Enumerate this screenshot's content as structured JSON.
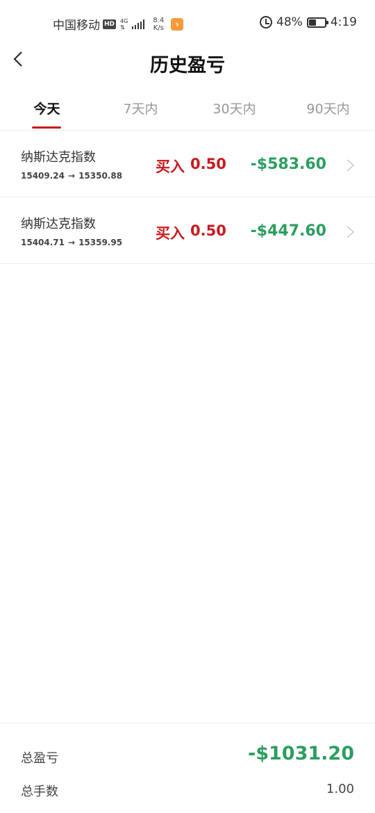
{
  "status_bar": {
    "carrier": "中国移动",
    "hd": "HD",
    "network": "4G",
    "net_speed_value": "8.4",
    "net_speed_unit": "K/s",
    "battery_percent": "48%",
    "battery_level": 0.48,
    "time": "4:19"
  },
  "header": {
    "title": "历史盈亏"
  },
  "tabs": [
    {
      "label": "今天",
      "active": true
    },
    {
      "label": "7天内",
      "active": false
    },
    {
      "label": "30天内",
      "active": false
    },
    {
      "label": "90天内",
      "active": false
    }
  ],
  "trades": [
    {
      "name": "纳斯达克指数",
      "open_price": "15409.24",
      "close_price": "15350.88",
      "side": "买入",
      "lots": "0.50",
      "pnl": "-$583.60"
    },
    {
      "name": "纳斯达克指数",
      "open_price": "15404.71",
      "close_price": "15359.95",
      "side": "买入",
      "lots": "0.50",
      "pnl": "-$447.60"
    }
  ],
  "footer": {
    "total_pnl_label": "总盈亏",
    "total_pnl": "-$1031.20",
    "total_lots_label": "总手数",
    "total_lots": "1.00"
  },
  "colors": {
    "accent_red": "#c8191f",
    "loss_green": "#2c9e60"
  }
}
